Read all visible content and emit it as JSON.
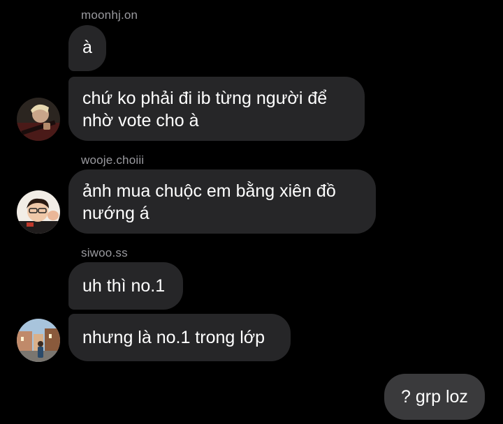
{
  "messages": [
    {
      "sender": "moonhj.on",
      "bubbles": [
        "à",
        "chứ ko phải đi ib từng người để",
        "nhờ vote cho à"
      ],
      "avatar_icon": "avatar-moonhj-icon"
    },
    {
      "sender": "wooje.choiii",
      "bubbles": [
        "ảnh mua chuộc em bằng xiên đồ",
        "nướng á"
      ],
      "avatar_icon": "avatar-wooje-icon"
    },
    {
      "sender": "siwoo.ss",
      "bubbles": [
        "uh thì no.1",
        "nhưng là no.1 trong lớp"
      ],
      "avatar_icon": "avatar-siwoo-icon"
    }
  ],
  "outgoing": {
    "text": "? grp loz"
  },
  "colors": {
    "background": "#000000",
    "incoming_bubble": "#262628",
    "outgoing_bubble": "#3a3a3c",
    "sender_name": "#9a9a9f",
    "text": "#ffffff"
  }
}
